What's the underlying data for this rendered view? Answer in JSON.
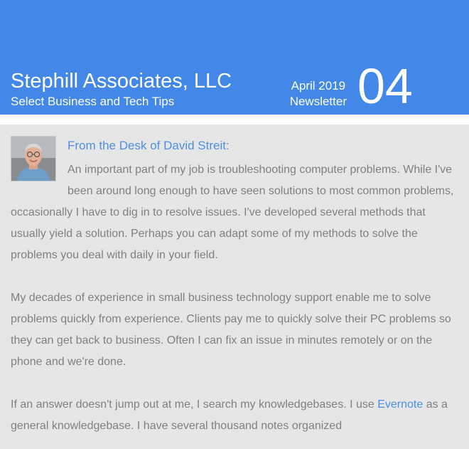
{
  "header": {
    "company": "Stephill Associates, LLC",
    "tagline": "Select Business and Tech Tips",
    "issue_date": "April 2019",
    "issue_type": "Newsletter",
    "issue_number": "04"
  },
  "article": {
    "heading": "From the Desk of David Streit:",
    "para1": "An important part of my job is troubleshooting computer problems.  While I've been around long enough to have seen solutions to most common problems, occasionally I have to dig in to resolve issues. I've developed several methods that usually yield a solution.  Perhaps you can adapt some of my methods to solve the problems you deal with daily in your field.",
    "para2": "My decades of experience in small business technology support enable me to solve problems quickly from experience.  Clients pay me to quickly solve their PC problems so they can get back to business.  Often I can fix an issue in minutes remotely or on the phone and we're done.",
    "para3_before": "If an answer doesn't jump out at me, I search my knowledgebases.  I use ",
    "para3_link": "Evernote",
    "para3_after": " as a general knowledgebase.  I have several thousand notes organized"
  },
  "colors": {
    "header_bg": "#4388e8",
    "content_bg": "#e6e6e6",
    "body_text": "#808080",
    "link": "#4b8fe0"
  }
}
